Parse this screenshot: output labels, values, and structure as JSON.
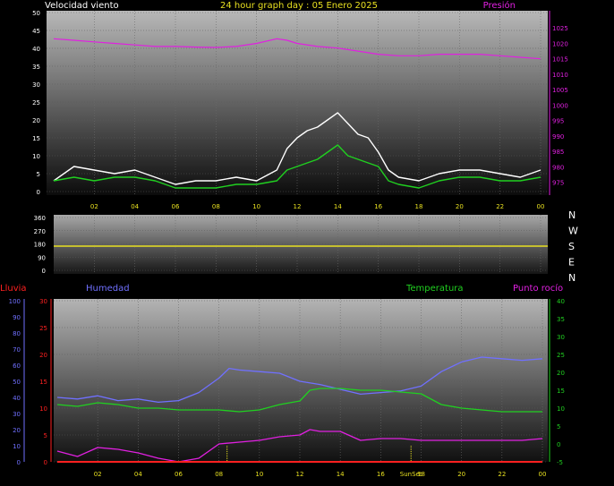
{
  "header": {
    "title": "24 hour graph day : 05 Enero 2025"
  },
  "colors": {
    "background": "#000000",
    "wind_gust": "#ffffff",
    "wind_avg": "#20d020",
    "wind_low": "#b0ffb0",
    "pressure": "#e020e0",
    "direction": "#e8e020",
    "humidity": "#7070ff",
    "temperature": "#20d020",
    "dewpoint": "#e020e0",
    "rain": "#ff2020",
    "tick_yellow": "#e8e020"
  },
  "chart_data": [
    {
      "type": "line",
      "id": "wind_pressure",
      "left_axis_label": "Velocidad viento",
      "right_axis_label": "Presión",
      "x_ticks": [
        "02",
        "04",
        "06",
        "08",
        "10",
        "12",
        "14",
        "16",
        "18",
        "20",
        "22",
        "00"
      ],
      "x_range_hours": [
        0,
        24
      ],
      "left_ylim": [
        0,
        50
      ],
      "left_yticks": [
        "0",
        "5",
        "10",
        "15",
        "20",
        "25",
        "30",
        "35",
        "40",
        "45",
        "50"
      ],
      "right_ylim": [
        972,
        1030
      ],
      "right_yticks": [
        "975",
        "980",
        "985",
        "990",
        "995",
        "1000",
        "1005",
        "1010",
        "1015",
        "1020",
        "1025"
      ],
      "grid": true,
      "series": [
        {
          "key": "gust",
          "color": "#ffffff",
          "values": [
            [
              0,
              3
            ],
            [
              1,
              7
            ],
            [
              2,
              6
            ],
            [
              3,
              5
            ],
            [
              4,
              6
            ],
            [
              5,
              4
            ],
            [
              6,
              2
            ],
            [
              7,
              3
            ],
            [
              8,
              3
            ],
            [
              9,
              4
            ],
            [
              10,
              3
            ],
            [
              11,
              6
            ],
            [
              11.5,
              12
            ],
            [
              12,
              15
            ],
            [
              12.5,
              17
            ],
            [
              13,
              18
            ],
            [
              13.5,
              20
            ],
            [
              14,
              22
            ],
            [
              14.5,
              19
            ],
            [
              15,
              16
            ],
            [
              15.5,
              15
            ],
            [
              16,
              11
            ],
            [
              16.5,
              6
            ],
            [
              17,
              4
            ],
            [
              18,
              3
            ],
            [
              19,
              5
            ],
            [
              20,
              6
            ],
            [
              21,
              6
            ],
            [
              22,
              5
            ],
            [
              23,
              4
            ],
            [
              24,
              6
            ]
          ]
        },
        {
          "key": "avg",
          "color": "#20d020",
          "values": [
            [
              0,
              3
            ],
            [
              1,
              4
            ],
            [
              2,
              3
            ],
            [
              3,
              4
            ],
            [
              4,
              4
            ],
            [
              5,
              3
            ],
            [
              6,
              1
            ],
            [
              7,
              1
            ],
            [
              8,
              1
            ],
            [
              9,
              2
            ],
            [
              10,
              2
            ],
            [
              11,
              3
            ],
            [
              11.5,
              6
            ],
            [
              12,
              7
            ],
            [
              12.5,
              8
            ],
            [
              13,
              9
            ],
            [
              13.5,
              11
            ],
            [
              14,
              13
            ],
            [
              14.5,
              10
            ],
            [
              15,
              9
            ],
            [
              15.5,
              8
            ],
            [
              16,
              7
            ],
            [
              16.5,
              3
            ],
            [
              17,
              2
            ],
            [
              18,
              1
            ],
            [
              19,
              3
            ],
            [
              20,
              4
            ],
            [
              21,
              4
            ],
            [
              22,
              3
            ],
            [
              23,
              3
            ],
            [
              24,
              4
            ]
          ]
        },
        {
          "key": "pressure",
          "color": "#e020e0",
          "values": [
            [
              0,
              1021.5
            ],
            [
              1,
              1021
            ],
            [
              2,
              1020.5
            ],
            [
              3,
              1020
            ],
            [
              4,
              1019.5
            ],
            [
              5,
              1019
            ],
            [
              6,
              1019
            ],
            [
              7,
              1018.8
            ],
            [
              8,
              1018.7
            ],
            [
              9,
              1019
            ],
            [
              10,
              1020
            ],
            [
              11,
              1021.5
            ],
            [
              11.5,
              1021
            ],
            [
              12,
              1020
            ],
            [
              13,
              1019
            ],
            [
              14,
              1018.5
            ],
            [
              15,
              1017.5
            ],
            [
              16,
              1016.5
            ],
            [
              17,
              1016
            ],
            [
              18,
              1016
            ],
            [
              19,
              1016.5
            ],
            [
              20,
              1016.5
            ],
            [
              21,
              1016.5
            ],
            [
              22,
              1016
            ],
            [
              23,
              1015.5
            ],
            [
              24,
              1015
            ]
          ]
        }
      ]
    },
    {
      "type": "line",
      "id": "wind_direction",
      "left_yticks": [
        "0",
        "90",
        "180",
        "270",
        "360"
      ],
      "ylim": [
        0,
        360
      ],
      "right_labels": [
        "N",
        "W",
        "S",
        "E",
        "N"
      ],
      "series": [
        {
          "key": "direction",
          "color": "#e8e020",
          "values": [
            [
              0,
              165
            ],
            [
              24,
              165
            ]
          ]
        }
      ]
    },
    {
      "type": "line",
      "id": "temp_humidity",
      "labels": {
        "rain": "Lluvia",
        "humidity": "Humedad",
        "temperature": "Temperatura",
        "dewpoint": "Punto rocío"
      },
      "x_ticks": [
        "02",
        "04",
        "06",
        "08",
        "10",
        "12",
        "14",
        "16",
        "18",
        "20",
        "22",
        "00"
      ],
      "sunset_label": "SunSet",
      "humidity_ylim": [
        0,
        100
      ],
      "humidity_ticks": [
        "0",
        "10",
        "20",
        "30",
        "40",
        "50",
        "60",
        "70",
        "80",
        "90",
        "100"
      ],
      "rain_ylim": [
        0,
        30
      ],
      "rain_ticks": [
        "0",
        "5",
        "10",
        "15",
        "20",
        "25",
        "30"
      ],
      "temp_ylim": [
        -5,
        40
      ],
      "temp_ticks": [
        "-5",
        "0",
        "5",
        "10",
        "15",
        "20",
        "25",
        "30",
        "35",
        "40"
      ],
      "series": [
        {
          "key": "humidity",
          "color": "#7070ff",
          "values": [
            [
              0,
              40
            ],
            [
              1,
              39
            ],
            [
              2,
              41
            ],
            [
              3,
              38
            ],
            [
              4,
              39
            ],
            [
              5,
              37
            ],
            [
              6,
              38
            ],
            [
              7,
              43
            ],
            [
              8,
              52
            ],
            [
              8.5,
              58
            ],
            [
              9,
              57
            ],
            [
              10,
              56
            ],
            [
              11,
              55
            ],
            [
              12,
              50
            ],
            [
              13,
              48
            ],
            [
              14,
              45
            ],
            [
              15,
              42
            ],
            [
              16,
              43
            ],
            [
              17,
              44
            ],
            [
              18,
              47
            ],
            [
              19,
              56
            ],
            [
              20,
              62
            ],
            [
              21,
              65
            ],
            [
              22,
              64
            ],
            [
              23,
              63
            ],
            [
              24,
              64
            ]
          ]
        },
        {
          "key": "temperature",
          "color": "#20d020",
          "values": [
            [
              0,
              11
            ],
            [
              1,
              10.5
            ],
            [
              2,
              11.5
            ],
            [
              3,
              11
            ],
            [
              4,
              10
            ],
            [
              5,
              10
            ],
            [
              6,
              9.5
            ],
            [
              7,
              9.5
            ],
            [
              8,
              9.5
            ],
            [
              9,
              9
            ],
            [
              10,
              9.5
            ],
            [
              11,
              11
            ],
            [
              12,
              12
            ],
            [
              12.5,
              15
            ],
            [
              13,
              15.5
            ],
            [
              14,
              15.5
            ],
            [
              15,
              15
            ],
            [
              16,
              15
            ],
            [
              17,
              14.5
            ],
            [
              18,
              14
            ],
            [
              19,
              11
            ],
            [
              20,
              10
            ],
            [
              21,
              9.5
            ],
            [
              22,
              9
            ],
            [
              23,
              9
            ],
            [
              24,
              9
            ]
          ]
        },
        {
          "key": "dewpoint",
          "color": "#e020e0",
          "values": [
            [
              0,
              -2
            ],
            [
              1,
              -3.5
            ],
            [
              2,
              -1
            ],
            [
              3,
              -1.5
            ],
            [
              4,
              -2.5
            ],
            [
              5,
              -4
            ],
            [
              6,
              -5
            ],
            [
              7,
              -4
            ],
            [
              8,
              0
            ],
            [
              9,
              0.5
            ],
            [
              10,
              1
            ],
            [
              11,
              2
            ],
            [
              12,
              2.5
            ],
            [
              12.5,
              4
            ],
            [
              13,
              3.5
            ],
            [
              14,
              3.5
            ],
            [
              15,
              1
            ],
            [
              16,
              1.5
            ],
            [
              17,
              1.5
            ],
            [
              18,
              1
            ],
            [
              19,
              1
            ],
            [
              20,
              1
            ],
            [
              21,
              1
            ],
            [
              22,
              1
            ],
            [
              23,
              1
            ],
            [
              24,
              1.5
            ]
          ]
        },
        {
          "key": "rain",
          "color": "#ff2020",
          "values": [
            [
              0,
              0
            ],
            [
              24,
              0
            ]
          ]
        }
      ]
    }
  ]
}
